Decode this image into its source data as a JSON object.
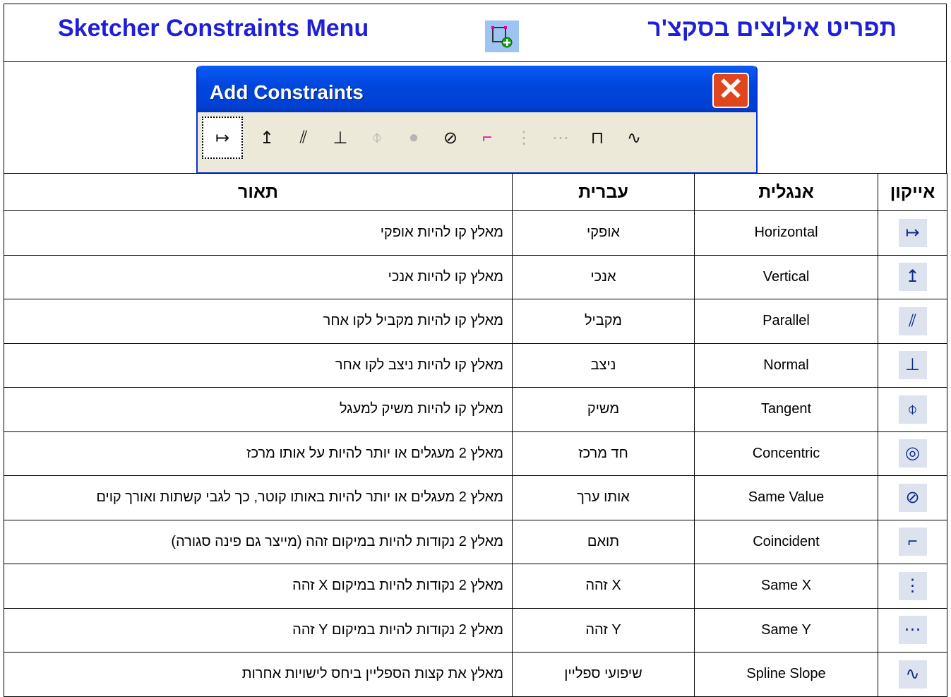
{
  "header": {
    "title_en": "Sketcher Constraints Menu",
    "title_he": "תפריט אילוצים בסקצ'ר",
    "icon": "sketcher-constraint-icon"
  },
  "toolbar": {
    "title": "Add Constraints",
    "close_label": "✕",
    "icons": [
      {
        "name": "horizontal-constraint-icon",
        "glyph": "↦",
        "state": "selected"
      },
      {
        "name": "vertical-constraint-icon",
        "glyph": "↥",
        "state": "normal"
      },
      {
        "name": "parallel-constraint-icon",
        "glyph": "⫽",
        "state": "normal"
      },
      {
        "name": "normal-constraint-icon",
        "glyph": "⊥",
        "state": "normal"
      },
      {
        "name": "tangent-constraint-icon",
        "glyph": "⌽",
        "state": "dim"
      },
      {
        "name": "concentric-constraint-icon",
        "glyph": "●",
        "state": "dim"
      },
      {
        "name": "same-value-constraint-icon",
        "glyph": "⊘",
        "state": "normal"
      },
      {
        "name": "coincident-constraint-icon",
        "glyph": "⌐",
        "state": "pink"
      },
      {
        "name": "same-x-constraint-icon",
        "glyph": "⋮",
        "state": "dim"
      },
      {
        "name": "same-y-constraint-icon",
        "glyph": "⋯",
        "state": "dim"
      },
      {
        "name": "fix-constraint-icon",
        "glyph": "⊓",
        "state": "normal"
      },
      {
        "name": "spline-slope-constraint-icon",
        "glyph": "∿",
        "state": "normal"
      }
    ]
  },
  "table": {
    "headers": {
      "icon": "אייקון",
      "english": "אנגלית",
      "hebrew": "עברית",
      "description": "תאור"
    },
    "rows": [
      {
        "icon": "horizontal-constraint-icon",
        "glyph": "↦",
        "english": "Horizontal",
        "hebrew": "אופקי",
        "description": "מאלץ קו להיות אופקי"
      },
      {
        "icon": "vertical-constraint-icon",
        "glyph": "↥",
        "english": "Vertical",
        "hebrew": "אנכי",
        "description": "מאלץ קו להיות אנכי"
      },
      {
        "icon": "parallel-constraint-icon",
        "glyph": "⫽",
        "english": "Parallel",
        "hebrew": "מקביל",
        "description": "מאלץ קו להיות מקביל לקו אחר"
      },
      {
        "icon": "normal-constraint-icon",
        "glyph": "⊥",
        "english": "Normal",
        "hebrew": "ניצב",
        "description": "מאלץ קו להיות ניצב לקו אחר"
      },
      {
        "icon": "tangent-constraint-icon",
        "glyph": "⌽",
        "english": "Tangent",
        "hebrew": "משיק",
        "description": "מאלץ קו להיות משיק למעגל"
      },
      {
        "icon": "concentric-constraint-icon",
        "glyph": "◎",
        "english": "Concentric",
        "hebrew": "חד מרכז",
        "description": "מאלץ 2 מעגלים או יותר להיות על אותו מרכז"
      },
      {
        "icon": "same-value-constraint-icon",
        "glyph": "⊘",
        "english": "Same Value",
        "hebrew": "אותו ערך",
        "description": "מאלץ 2 מעגלים או יותר להיות באותו קוטר, כך לגבי קשתות ואורך קוים"
      },
      {
        "icon": "coincident-constraint-icon",
        "glyph": "⌐",
        "english": "Coincident",
        "hebrew": "תואם",
        "description": "מאלץ 2 נקודות להיות במיקום זהה (מייצר גם פינה סגורה)"
      },
      {
        "icon": "same-x-constraint-icon",
        "glyph": "⋮",
        "english": "Same X",
        "hebrew": "X זהה",
        "description": "מאלץ 2 נקודות להיות במיקום  X זהה"
      },
      {
        "icon": "same-y-constraint-icon",
        "glyph": "⋯",
        "english": "Same Y",
        "hebrew": "Y זהה",
        "description": "מאלץ 2 נקודות להיות במיקום Y זהה"
      },
      {
        "icon": "spline-slope-constraint-icon",
        "glyph": "∿",
        "english": "Spline Slope",
        "hebrew": "שיפועי ספליין",
        "description": "מאלץ את קצות הספליין ביחס לישויות אחרות"
      }
    ]
  }
}
